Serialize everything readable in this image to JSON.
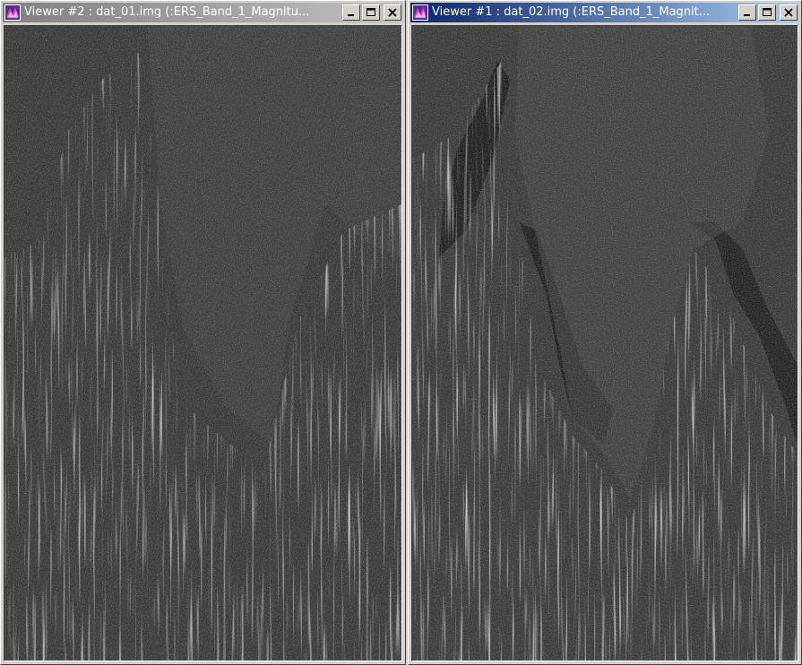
{
  "viewers": [
    {
      "title": "Viewer #2 : dat_01.img (:ERS_Band_1_Magnitu...",
      "active": false,
      "image_name": "sar-image-dat-01"
    },
    {
      "title": "Viewer #1 : dat_02.img (:ERS_Band_1_Magnit...",
      "active": true,
      "image_name": "sar-image-dat-02"
    }
  ],
  "colors": {
    "active_title_start": "#0a246a",
    "active_title_end": "#a6caf0",
    "inactive_title_start": "#808080",
    "inactive_title_end": "#c0c0c0",
    "window_face": "#d4d0c8"
  },
  "icons": {
    "app": "viewer-app-icon",
    "minimize": "minimize-icon",
    "maximize": "maximize-icon",
    "close": "close-icon"
  }
}
